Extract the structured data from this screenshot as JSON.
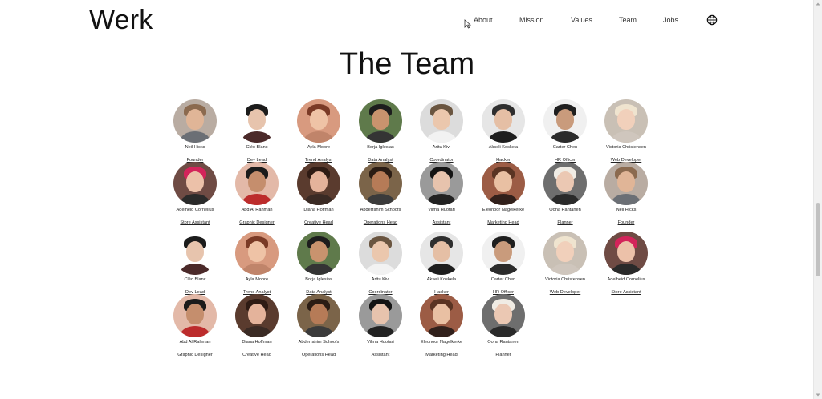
{
  "brand": {
    "logo": "Werk"
  },
  "nav": {
    "items": [
      {
        "label": "About"
      },
      {
        "label": "Mission"
      },
      {
        "label": "Values"
      },
      {
        "label": "Team"
      },
      {
        "label": "Jobs"
      }
    ],
    "language_icon": "globe-icon"
  },
  "team": {
    "title": "The Team",
    "members": [
      {
        "name": "Neil Hicks",
        "role": "Founder"
      },
      {
        "name": "Cléo Blanc",
        "role": "Dev Lead"
      },
      {
        "name": "Ayla Moore",
        "role": "Trend Analyst"
      },
      {
        "name": "Borja Iglesias",
        "role": "Data Analyst"
      },
      {
        "name": "Arttu Kivi",
        "role": "Coordinator"
      },
      {
        "name": "Akseli Koskela",
        "role": "Hacker"
      },
      {
        "name": "Carter Chen",
        "role": "HR Officer"
      },
      {
        "name": "Victoria Christensen",
        "role": "Web Developer"
      },
      {
        "name": "Adelheid Cornelius",
        "role": "Store Assistant"
      },
      {
        "name": "Abd Al Rahman",
        "role": "Graphic Designer"
      },
      {
        "name": "Diana Hoffman",
        "role": "Creative Head"
      },
      {
        "name": "Abderrahim Schoofs",
        "role": "Operations Head"
      },
      {
        "name": "Vilma Huotari",
        "role": "Assistant"
      },
      {
        "name": "Eleonoor Nagelkerke",
        "role": "Marketing Head"
      },
      {
        "name": "Oona Rantanen",
        "role": "Planner"
      },
      {
        "name": "Neil Hicks",
        "role": "Founder"
      },
      {
        "name": "Cléo Blanc",
        "role": "Dev Lead"
      },
      {
        "name": "Ayla Moore",
        "role": "Trend Analyst"
      },
      {
        "name": "Borja Iglesias",
        "role": "Data Analyst"
      },
      {
        "name": "Arttu Kivi",
        "role": "Coordinator"
      },
      {
        "name": "Akseli Koskela",
        "role": "Hacker"
      },
      {
        "name": "Carter Chen",
        "role": "HR Officer"
      },
      {
        "name": "Victoria Christensen",
        "role": "Web Developer"
      },
      {
        "name": "Adelheid Cornelius",
        "role": "Store Assistant"
      },
      {
        "name": "Abd Al Rahman",
        "role": "Graphic Designer"
      },
      {
        "name": "Diana Hoffman",
        "role": "Creative Head"
      },
      {
        "name": "Abderrahim Schoofs",
        "role": "Operations Head"
      },
      {
        "name": "Vilma Huotari",
        "role": "Assistant"
      },
      {
        "name": "Eleonoor Nagelkerke",
        "role": "Marketing Head"
      },
      {
        "name": "Oona Rantanen",
        "role": "Planner"
      }
    ]
  }
}
